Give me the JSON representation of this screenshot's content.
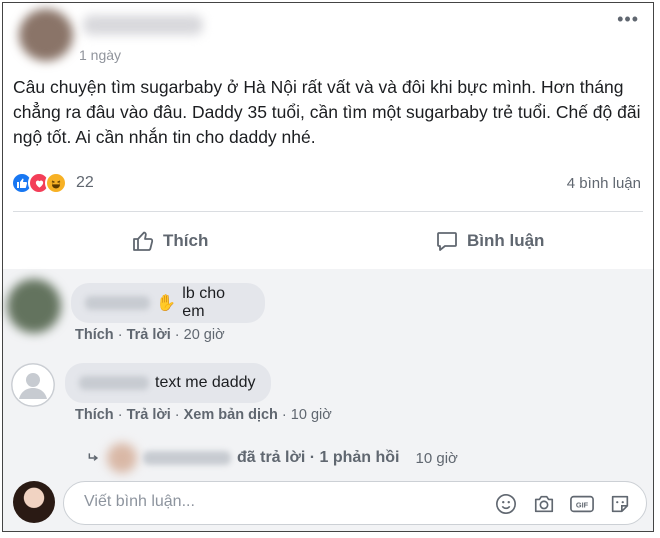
{
  "post": {
    "time": "1 ngày",
    "more": "•••",
    "text": "Câu chuyện tìm sugarbaby ở Hà Nội rất vất và và đôi khi bực mình. Hơn tháng chẳng ra đâu vào đâu. Daddy 35 tuổi, cần tìm một sugarbaby trẻ tuổi. Chế độ đãi ngộ tốt. Ai cần nhắn tin cho daddy nhé.",
    "reactions_count": "22",
    "comments_count": "4 bình luận"
  },
  "actions": {
    "like": "Thích",
    "comment": "Bình luận"
  },
  "comments": [
    {
      "text": "lb cho em",
      "like": "Thích",
      "reply": "Trả lời",
      "time": "20 giờ"
    },
    {
      "text": "text me daddy",
      "like": "Thích",
      "reply": "Trả lời",
      "translate": "Xem bản dịch",
      "time": "10 giờ"
    }
  ],
  "reply_summary": {
    "text": "đã trả lời · 1 phản hồi",
    "time": "10 giờ"
  },
  "composer": {
    "placeholder": "Viết bình luận..."
  },
  "separator": " · ",
  "icons": [
    "thumbs-up-icon",
    "comment-icon",
    "emoji-icon",
    "camera-icon",
    "gif-icon",
    "sticker-icon",
    "reply-arrow-icon"
  ],
  "colors": {
    "like": "#1877f2",
    "love": "#f33e58",
    "haha": "#f7b125",
    "muted": "#606770"
  }
}
